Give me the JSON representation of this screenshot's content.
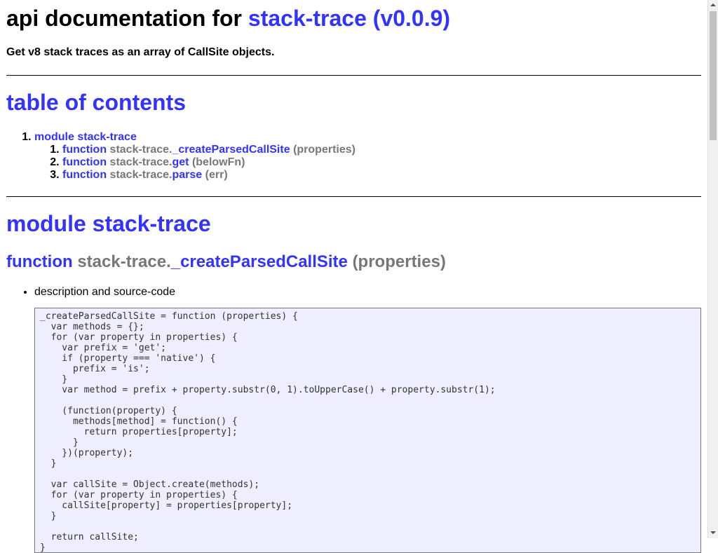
{
  "header": {
    "title_prefix": "api documentation for",
    "title_link": "stack-trace (v0.0.9)",
    "description": "Get v8 stack traces as an array of CallSite objects."
  },
  "toc": {
    "title": "table of contents",
    "module": "module stack-trace",
    "items": [
      {
        "kw": "function",
        "ns": "stack-trace.",
        "name": "_createParsedCallSite",
        "args": "(properties)"
      },
      {
        "kw": "function",
        "ns": "stack-trace.",
        "name": "get",
        "args": "(belowFn)"
      },
      {
        "kw": "function",
        "ns": "stack-trace.",
        "name": "parse",
        "args": "(err)"
      }
    ]
  },
  "module": {
    "title": "module stack-trace",
    "function": {
      "kw": "function",
      "ns": "stack-trace.",
      "name": "_createParsedCallSite",
      "args": "(properties)",
      "bullet": "description and source-code",
      "code": "_createParsedCallSite = function (properties) {\n  var methods = {};\n  for (var property in properties) {\n    var prefix = 'get';\n    if (property === 'native') {\n      prefix = 'is';\n    }\n    var method = prefix + property.substr(0, 1).toUpperCase() + property.substr(1);\n\n    (function(property) {\n      methods[method] = function() {\n        return properties[property];\n      }\n    })(property);\n  }\n\n  var callSite = Object.create(methods);\n  for (var property in properties) {\n    callSite[property] = properties[property];\n  }\n\n  return callSite;\n}"
    }
  },
  "colors": {
    "link": "#3333ff",
    "muted": "#777777",
    "code_bg": "#eeeeff"
  },
  "icons": [
    "scroll-up-icon",
    "scroll-down-icon"
  ]
}
